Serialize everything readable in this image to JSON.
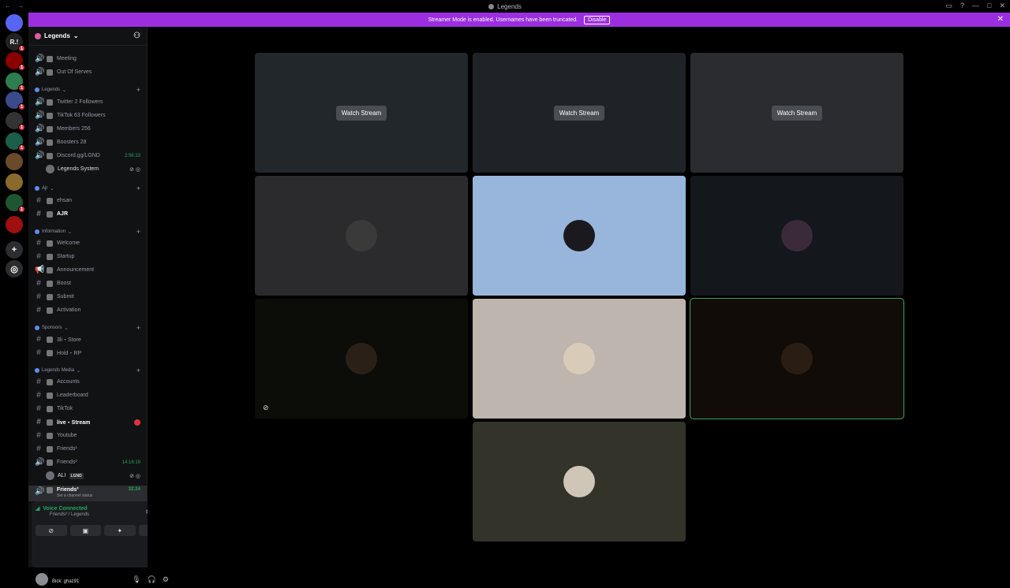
{
  "window": {
    "title": "Legends"
  },
  "banner": {
    "text": "Streamer Mode is enabled. Usernames have been truncated.",
    "disable_label": "Disable"
  },
  "servers": [
    {
      "label": "",
      "badge": "",
      "color": "#5865f2"
    },
    {
      "label": "R.!",
      "badge": "1",
      "color": "#222222"
    },
    {
      "label": "",
      "badge": "1",
      "color": "#8b0000"
    },
    {
      "label": "",
      "badge": "1",
      "color": "#2e7d4f"
    },
    {
      "label": "",
      "badge": "1",
      "color": "#3a4a8a"
    },
    {
      "label": "",
      "badge": "1",
      "color": "#333333"
    },
    {
      "label": "",
      "badge": "1",
      "color": "#1b5e4a"
    },
    {
      "label": "",
      "badge": "",
      "color": "#6b4a2a"
    },
    {
      "label": "",
      "badge": "",
      "color": "#8a6a2a"
    },
    {
      "label": "",
      "badge": "1",
      "color": "#1e5631"
    },
    {
      "label": "",
      "badge": "",
      "color": "#9e0f0f"
    }
  ],
  "guild": {
    "name": "Legends"
  },
  "channels": [
    {
      "type": "voice",
      "label": "Meeting"
    },
    {
      "type": "voice",
      "label": "Out Of Serves"
    },
    {
      "type": "category",
      "label": "Legends"
    },
    {
      "type": "voice",
      "label": "Twitter 2 Followers"
    },
    {
      "type": "voice",
      "label": "TikTok 63 Followers"
    },
    {
      "type": "voice",
      "label": "Members 256"
    },
    {
      "type": "voice",
      "label": "Boosters 28"
    },
    {
      "type": "voice",
      "label": "Discord.gg/LGND",
      "time": "2:56:33"
    },
    {
      "type": "user",
      "label": "Legends System"
    },
    {
      "type": "category",
      "label": "Ajr"
    },
    {
      "type": "text",
      "label": "ehsan"
    },
    {
      "type": "text",
      "label": "AJR",
      "active": true
    },
    {
      "type": "category",
      "label": "Information"
    },
    {
      "type": "text",
      "label": "Welcome"
    },
    {
      "type": "text",
      "label": "Startup"
    },
    {
      "type": "announce",
      "label": "Announcement"
    },
    {
      "type": "text",
      "label": "Boost"
    },
    {
      "type": "text",
      "label": "Submit"
    },
    {
      "type": "text",
      "label": "Activation"
    },
    {
      "type": "category",
      "label": "Sponsors"
    },
    {
      "type": "text",
      "label": "3li・Store"
    },
    {
      "type": "text",
      "label": "Hold・RP"
    },
    {
      "type": "category",
      "label": "Legends Media"
    },
    {
      "type": "text",
      "label": "Accounts"
    },
    {
      "type": "text",
      "label": "Leaderboard"
    },
    {
      "type": "text",
      "label": "TikTok"
    },
    {
      "type": "text",
      "label": "live・Stream",
      "active": true,
      "notify": true
    },
    {
      "type": "text",
      "label": "Youtube"
    },
    {
      "type": "text",
      "label": "Friends¹"
    },
    {
      "type": "voice",
      "label": "Friends²",
      "time": "14:16:19"
    },
    {
      "type": "user",
      "label": "ALI",
      "tag": "LGND"
    },
    {
      "type": "voice",
      "label": "Friends³",
      "time": "32:24",
      "active": true,
      "status": "Set a channel status"
    }
  ],
  "voice": {
    "status": "Voice Connected",
    "channel": "Friends³ / Legends"
  },
  "user": {
    "name": "",
    "tag": "Bick: ghaz91"
  },
  "tiles": [
    {
      "type": "stream",
      "label": "Watch Stream",
      "bg": "#22272b"
    },
    {
      "type": "stream",
      "label": "Watch Stream",
      "bg": "#1f2328"
    },
    {
      "type": "stream",
      "label": "Watch Stream",
      "bg": "#2a2c30"
    },
    {
      "type": "avatar",
      "bg": "#2b2b2d",
      "avatar_color": "#3a3a3a"
    },
    {
      "type": "avatar",
      "bg": "#98b6dc",
      "avatar_color": "#1a1a1e"
    },
    {
      "type": "avatar",
      "bg": "#14171b",
      "avatar_color": "#3b2a3a"
    },
    {
      "type": "avatar",
      "bg": "#0c0c08",
      "avatar_color": "#2a2018",
      "muted": true
    },
    {
      "type": "avatar",
      "bg": "#bdb5ae",
      "avatar_color": "#d8cbb8"
    },
    {
      "type": "avatar",
      "bg": "#120c08",
      "avatar_color": "#2a1e14",
      "speaking": true
    },
    {
      "type": "avatar",
      "bg": "#333329",
      "avatar_color": "#cfc6b8"
    }
  ]
}
